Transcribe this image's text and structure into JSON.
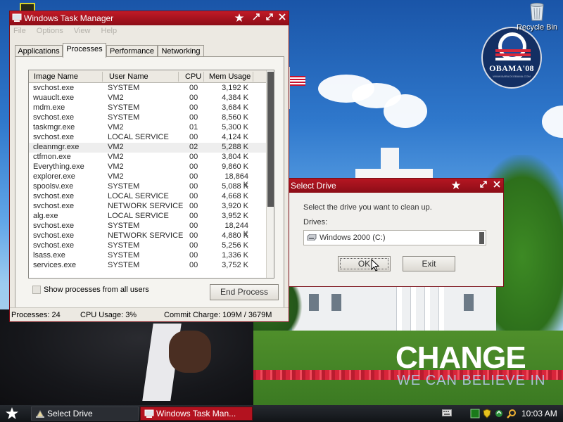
{
  "desktop": {
    "recycle_bin_label": "Recycle Bin",
    "poster": {
      "logo_word": "OBAMA'08",
      "logo_small": "WWW.BARACKOBAMA.COM",
      "headline": "CHANGE",
      "subline": "WE CAN BELIEVE IN"
    }
  },
  "taskmgr": {
    "title": "Windows Task Manager",
    "menu": [
      "File",
      "Options",
      "View",
      "Help"
    ],
    "tabs": [
      "Applications",
      "Processes",
      "Performance",
      "Networking"
    ],
    "active_tab": "Processes",
    "columns": [
      "Image Name",
      "User Name",
      "CPU",
      "Mem Usage"
    ],
    "processes": [
      {
        "name": "svchost.exe",
        "user": "SYSTEM",
        "cpu": "00",
        "mem": "3,192 K"
      },
      {
        "name": "wuauclt.exe",
        "user": "VM2",
        "cpu": "00",
        "mem": "4,384 K"
      },
      {
        "name": "mdm.exe",
        "user": "SYSTEM",
        "cpu": "00",
        "mem": "3,684 K"
      },
      {
        "name": "svchost.exe",
        "user": "SYSTEM",
        "cpu": "00",
        "mem": "8,560 K"
      },
      {
        "name": "taskmgr.exe",
        "user": "VM2",
        "cpu": "01",
        "mem": "5,300 K"
      },
      {
        "name": "svchost.exe",
        "user": "LOCAL SERVICE",
        "cpu": "00",
        "mem": "4,124 K"
      },
      {
        "name": "cleanmgr.exe",
        "user": "VM2",
        "cpu": "02",
        "mem": "5,288 K"
      },
      {
        "name": "ctfmon.exe",
        "user": "VM2",
        "cpu": "00",
        "mem": "3,804 K"
      },
      {
        "name": "Everything.exe",
        "user": "VM2",
        "cpu": "00",
        "mem": "9,860 K"
      },
      {
        "name": "explorer.exe",
        "user": "VM2",
        "cpu": "00",
        "mem": "18,864 K"
      },
      {
        "name": "spoolsv.exe",
        "user": "SYSTEM",
        "cpu": "00",
        "mem": "5,088 K"
      },
      {
        "name": "svchost.exe",
        "user": "LOCAL SERVICE",
        "cpu": "00",
        "mem": "4,668 K"
      },
      {
        "name": "svchost.exe",
        "user": "NETWORK SERVICE",
        "cpu": "00",
        "mem": "3,920 K"
      },
      {
        "name": "alg.exe",
        "user": "LOCAL SERVICE",
        "cpu": "00",
        "mem": "3,952 K"
      },
      {
        "name": "svchost.exe",
        "user": "SYSTEM",
        "cpu": "00",
        "mem": "18,244 K"
      },
      {
        "name": "svchost.exe",
        "user": "NETWORK SERVICE",
        "cpu": "00",
        "mem": "4,880 K"
      },
      {
        "name": "svchost.exe",
        "user": "SYSTEM",
        "cpu": "00",
        "mem": "5,256 K"
      },
      {
        "name": "lsass.exe",
        "user": "SYSTEM",
        "cpu": "00",
        "mem": "1,336 K"
      },
      {
        "name": "services.exe",
        "user": "SYSTEM",
        "cpu": "00",
        "mem": "3,752 K"
      }
    ],
    "selected_process": "cleanmgr.exe",
    "show_all_label": "Show processes from all users",
    "show_all_checked": false,
    "end_process_label": "End Process",
    "status": {
      "processes": "Processes: 24",
      "cpu": "CPU Usage: 3%",
      "commit": "Commit Charge: 109M / 3679M"
    }
  },
  "select_drive": {
    "title": "Select Drive",
    "prompt": "Select the drive you want to clean up.",
    "drives_label": "Drives:",
    "selected_drive": "Windows 2000 (C:)",
    "ok_label": "OK",
    "exit_label": "Exit"
  },
  "taskbar": {
    "tasks": [
      "Select Drive",
      "Windows Task Man..."
    ],
    "active_task": "Windows Task Man...",
    "clock": "10:03 AM"
  },
  "colors": {
    "titlebar": "#b3121f",
    "window_bg": "#ece9e2",
    "taskbar": "#1b1e22"
  },
  "icons": {
    "window_buttons": [
      "star-icon",
      "minimize-icon",
      "maximize-icon",
      "close-icon"
    ],
    "tray": [
      "keyboard-icon",
      "network-icon",
      "security-shield-icon",
      "update-icon",
      "search-icon"
    ]
  }
}
